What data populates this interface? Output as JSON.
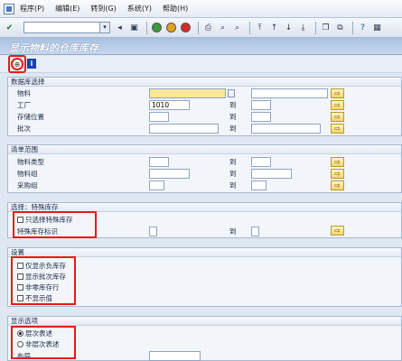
{
  "menu": {
    "items": [
      "程序(P)",
      "编辑(E)",
      "转到(G)",
      "系统(Y)",
      "帮助(H)"
    ]
  },
  "toolbar": {
    "command_value": "",
    "icons": [
      "check-icon",
      "save-icon",
      "back-icon",
      "exit-icon",
      "cancel-icon",
      "print-icon",
      "find-icon",
      "find-next-icon",
      "first-page-icon",
      "prev-page-icon",
      "next-page-icon",
      "last-page-icon",
      "new-session-icon",
      "shortcut-icon",
      "help-icon",
      "layout-icon"
    ]
  },
  "page": {
    "title": "显示物料的仓库库存",
    "execute_icon": "execute-icon",
    "info_icon": "info-icon",
    "info_glyph": "i"
  },
  "glyphs": {
    "check": "✔",
    "dropdown": "▾",
    "to_sep": "到",
    "multi": "⇨",
    "execute": "⊕"
  },
  "db_selection": {
    "header": "数据库选择",
    "rows": [
      {
        "label": "物料",
        "low": "",
        "high": ""
      },
      {
        "label": "工厂",
        "low": "1010",
        "high": ""
      },
      {
        "label": "存储位置",
        "low": "",
        "high": ""
      },
      {
        "label": "批次",
        "low": "",
        "high": ""
      }
    ]
  },
  "list_scope": {
    "header": "清单范围",
    "rows": [
      {
        "label": "物料类型",
        "low": "",
        "high": ""
      },
      {
        "label": "物料组",
        "low": "",
        "high": ""
      },
      {
        "label": "采购组",
        "low": "",
        "high": ""
      }
    ]
  },
  "special_stock": {
    "header": "选择：特殊库存",
    "checkbox_label": "只选择特殊库存",
    "row": {
      "label": "特殊库存标识",
      "low": "",
      "high": ""
    }
  },
  "settings": {
    "header": "设置",
    "options": [
      {
        "label": "仅显示负库存",
        "checked": false
      },
      {
        "label": "显示批次库存",
        "checked": false
      },
      {
        "label": "非零库存行",
        "checked": false
      },
      {
        "label": "不显示值",
        "checked": false
      }
    ]
  },
  "display_options": {
    "header": "显示选项",
    "options": [
      {
        "label": "层次表述",
        "selected": true
      },
      {
        "label": "非层次表述",
        "selected": false
      }
    ],
    "layout_label": "布局",
    "layout_value": ""
  }
}
